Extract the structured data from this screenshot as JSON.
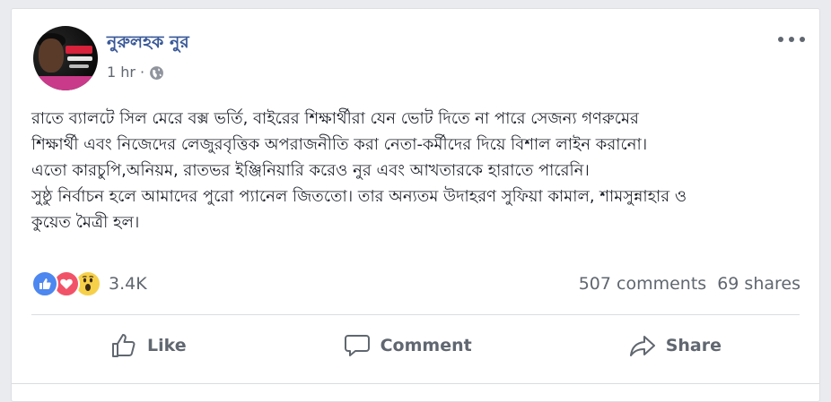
{
  "post": {
    "author": "নুরুলহক নুর",
    "time": "1 hr",
    "separator": "·",
    "privacy_icon": "globe-icon",
    "menu_icon": "more-horizontal-icon",
    "lines": [
      "রাতে ব্যালটে সিল মেরে বক্স ভর্তি, বাইরের শিক্ষার্থীরা যেন ভোট দিতে না পারে সেজন্য গণরুমের",
      "শিক্ষার্থী এবং নিজেদের লেজুরবৃত্তিক অপরাজনীতি করা নেতা-কর্মীদের দিয়ে বিশাল লাইন করানো।",
      "এতো কারচুপি,অনিয়ম, রাতভর ইঞ্জিনিয়ারি করেও নুর এবং আখতারকে হারাতে পারেনি।",
      "সুষ্ঠু নির্বাচন হলে আমাদের পুরো প্যানেল জিততো। তার অন্যতম উদাহরণ সুফিয়া কামাল, শামসুন্নাহার ও",
      "কুয়েত মৈত্রী হল।"
    ]
  },
  "engagement": {
    "reaction_icons": [
      "like-icon",
      "love-icon",
      "wow-icon"
    ],
    "reaction_count": "3.4K",
    "comments": "507 comments",
    "shares": "69 shares"
  },
  "actions": {
    "like": "Like",
    "comment": "Comment",
    "share": "Share"
  },
  "colors": {
    "link": "#385898",
    "muted": "#606770",
    "like": "#4d87f0",
    "love": "#f25268",
    "wow": "#f7d04a"
  }
}
